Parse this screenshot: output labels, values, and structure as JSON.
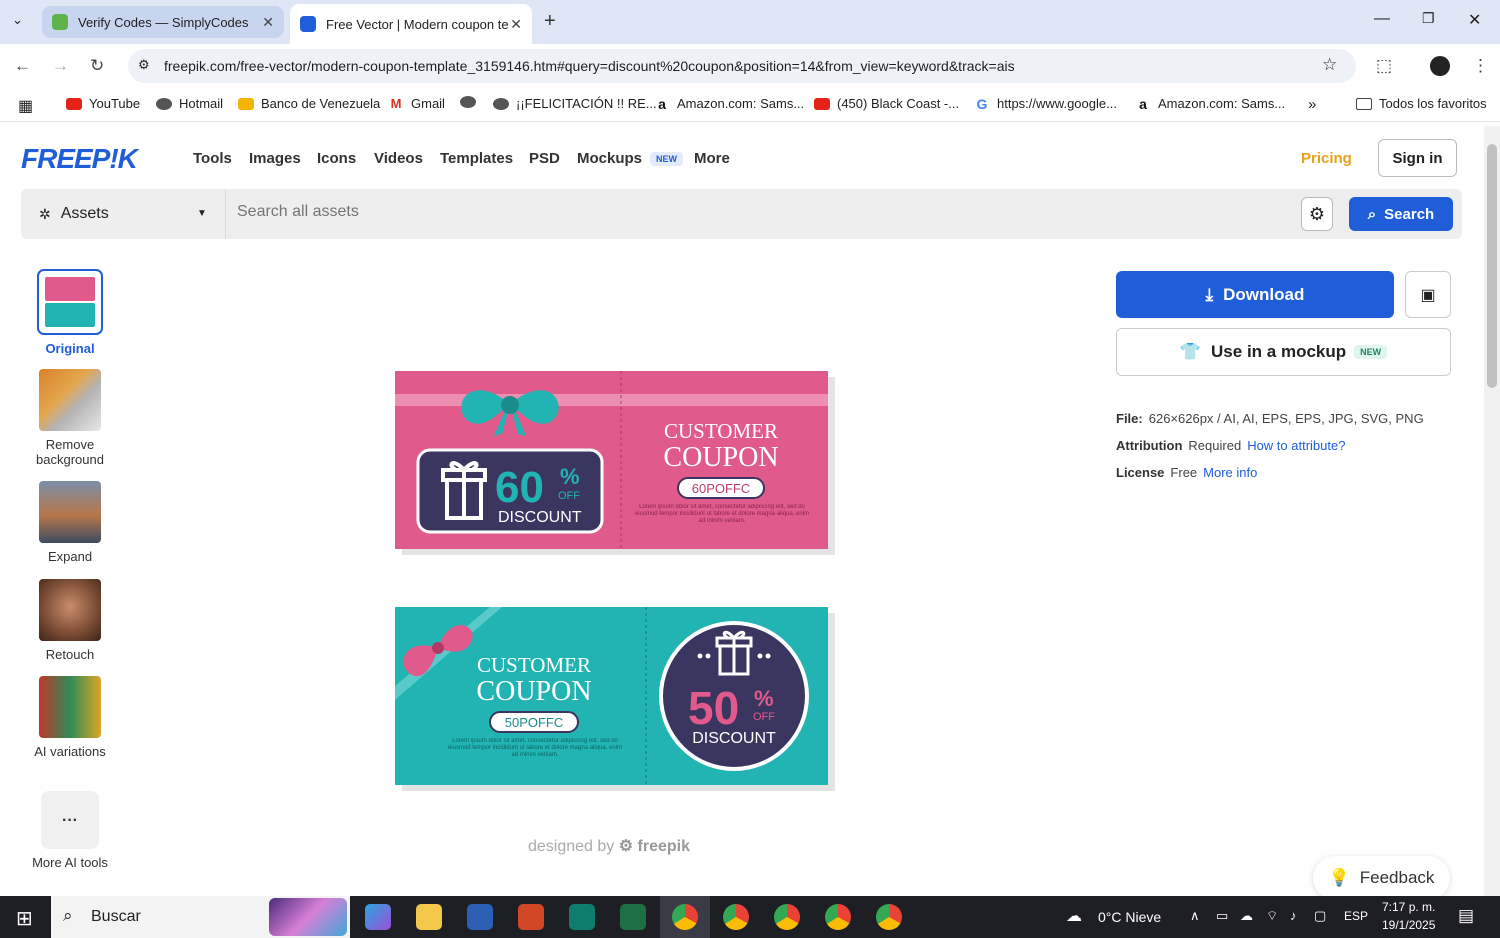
{
  "browser": {
    "tabs": [
      {
        "title": "Verify Codes — SimplyCodes",
        "active": false
      },
      {
        "title": "Free Vector | Modern coupon te",
        "active": true
      }
    ],
    "url": "freepik.com/free-vector/modern-coupon-template_3159146.htm#query=discount%20coupon&position=14&from_view=keyword&track=ais",
    "bookmarks": [
      "YouTube",
      "Hotmail",
      "Banco de Venezuela",
      "Gmail",
      "¡¡FELICITACIÓN !! RE...",
      "Amazon.com: Sams...",
      "(450) Black Coast -...",
      "https://www.google...",
      "Amazon.com: Sams...",
      "Todos los favoritos"
    ]
  },
  "site": {
    "logo": "FREEP!K",
    "nav": [
      "Tools",
      "Images",
      "Icons",
      "Videos",
      "Templates",
      "PSD",
      "Mockups",
      "More"
    ],
    "mockups_badge": "NEW",
    "pricing": "Pricing",
    "signin": "Sign in",
    "search": {
      "category": "Assets",
      "placeholder": "Search all assets",
      "button": "Search"
    }
  },
  "tools": [
    {
      "label": "Original",
      "icon": "coupon-thumbnail"
    },
    {
      "label": "Remove background",
      "icon": "balloon-thumbnail"
    },
    {
      "label": "Expand",
      "icon": "cabin-thumbnail"
    },
    {
      "label": "Retouch",
      "icon": "face-thumbnail"
    },
    {
      "label": "AI variations",
      "icon": "parrot-thumbnail"
    },
    {
      "label": "More AI tools",
      "icon": "more-icon"
    }
  ],
  "coupons": [
    {
      "title_line1": "CUSTOMER",
      "title_line2": "COUPON",
      "code": "60POFFC",
      "percent": "60",
      "percent_sign": "%",
      "off": "OFF",
      "discount": "DISCOUNT",
      "fine_print": "Lorem ipsum dolor sit amet, consectetur adipiscing elit, sed do eiusmod tempor incididunt ut labore et dolore magna aliqua, enim ad minim veniam."
    },
    {
      "title_line1": "CUSTOMER",
      "title_line2": "COUPON",
      "code": "50POFFC",
      "percent": "50",
      "percent_sign": "%",
      "off": "OFF",
      "discount": "DISCOUNT",
      "fine_print": "Lorem ipsum dolor sit amet, consectetur adipiscing elit, sed do eiusmod tempor incididunt ut labore et dolore magna aliqua, enim ad minim veniam."
    }
  ],
  "credit": {
    "prefix": "designed by",
    "brand": "freepik"
  },
  "sidebar": {
    "download": "Download",
    "mockup": "Use in a mockup",
    "mockup_badge": "NEW",
    "file_label": "File:",
    "file_value": "626×626px / AI, AI, EPS, EPS, JPG, SVG, PNG",
    "attribution_label": "Attribution",
    "attribution_value": "Required",
    "attribution_link": "How to attribute?",
    "license_label": "License",
    "license_value": "Free",
    "license_link": "More info"
  },
  "feedback": "Feedback",
  "taskbar": {
    "search": "Buscar",
    "weather": "0°C  Nieve",
    "lang": "ESP",
    "time": "7:17 p. m.",
    "date": "19/1/2025"
  },
  "colors": {
    "brand_blue": "#1f5ed8",
    "coupon_pink": "#e05a8b",
    "coupon_teal": "#22b3b3",
    "coupon_navy": "#3a3660",
    "pricing_orange": "#e8a11a"
  }
}
